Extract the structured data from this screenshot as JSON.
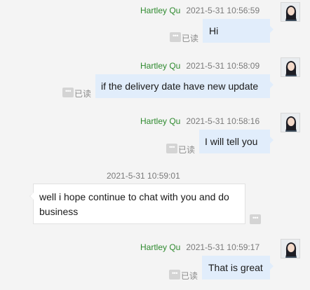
{
  "messages": [
    {
      "sender": "Hartley Qu",
      "timestamp": "2021-5-31 10:56:59",
      "text": "Hi",
      "status": "已读"
    },
    {
      "sender": "Hartley Qu",
      "timestamp": "2021-5-31 10:58:09",
      "text": "if the delivery date have new update",
      "status": "已读"
    },
    {
      "sender": "Hartley Qu",
      "timestamp": "2021-5-31 10:58:16",
      "text": "I will tell you",
      "status": "已读"
    },
    {
      "timestamp": "2021-5-31 10:59:01",
      "text": "well  i hope continue to chat with you and do business"
    },
    {
      "sender": "Hartley Qu",
      "timestamp": "2021-5-31 10:59:17",
      "text": "That is great",
      "status": "已读"
    }
  ],
  "icons": {
    "more": "more-options-icon",
    "avatar": "avatar"
  },
  "colors": {
    "sender_name": "#2f8a2f",
    "outgoing_bubble": "#e1edfb",
    "incoming_bubble": "#ffffff",
    "background": "#f4f4f4"
  }
}
